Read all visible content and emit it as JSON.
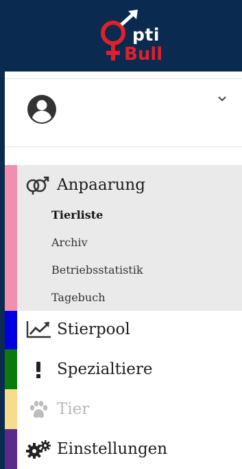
{
  "brand": {
    "logo_text_top": "pti",
    "logo_text_bottom": "Bull",
    "header_color": "#0b2a4f",
    "logo_red": "#e0202b"
  },
  "user": {
    "avatar_icon": "user-circle-icon",
    "menu_icon": "chevron-down-icon"
  },
  "menu": [
    {
      "label": "Anpaarung",
      "icon": "gender-mars-venus-icon",
      "stripe_color": "#f28fae",
      "expanded": true,
      "sub_items": [
        {
          "label": "Tierliste",
          "active": true
        },
        {
          "label": "Archiv",
          "active": false
        },
        {
          "label": "Betriebsstatistik",
          "active": false
        },
        {
          "label": "Tagebuch",
          "active": false
        }
      ]
    },
    {
      "label": "Stierpool",
      "icon": "chart-line-icon",
      "stripe_color": "#0000e0"
    },
    {
      "label": "Spezialtiere",
      "icon": "exclamation-icon",
      "stripe_color": "#0b7a0b"
    },
    {
      "label": "Tier",
      "icon": "paw-icon",
      "stripe_color": "#f8dc8e",
      "disabled": true
    },
    {
      "label": "Einstellungen",
      "icon": "cogs-icon",
      "stripe_color": "#5a2b8c"
    }
  ]
}
